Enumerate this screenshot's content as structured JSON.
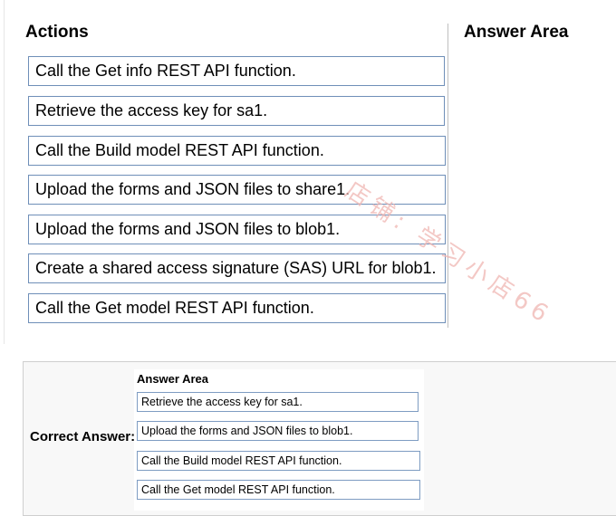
{
  "actions": {
    "title": "Actions",
    "items": [
      "Call the Get info REST API function.",
      "Retrieve the access key for sa1.",
      "Call the Build model REST API function.",
      "Upload the forms and JSON files to share1.",
      "Upload the forms and JSON files to blob1.",
      "Create a shared access signature (SAS) URL for blob1.",
      "Call the Get model REST API function."
    ]
  },
  "answer_area": {
    "title": "Answer Area"
  },
  "watermark": "店铺: 学习小店66",
  "correct_answer": {
    "label": "Correct Answer:",
    "answer_area_title": "Answer Area",
    "items": [
      "Retrieve the access key for sa1.",
      "Upload the forms and JSON files to blob1.",
      "Call the Build model REST API function.",
      "Call the Get model REST API function."
    ]
  }
}
